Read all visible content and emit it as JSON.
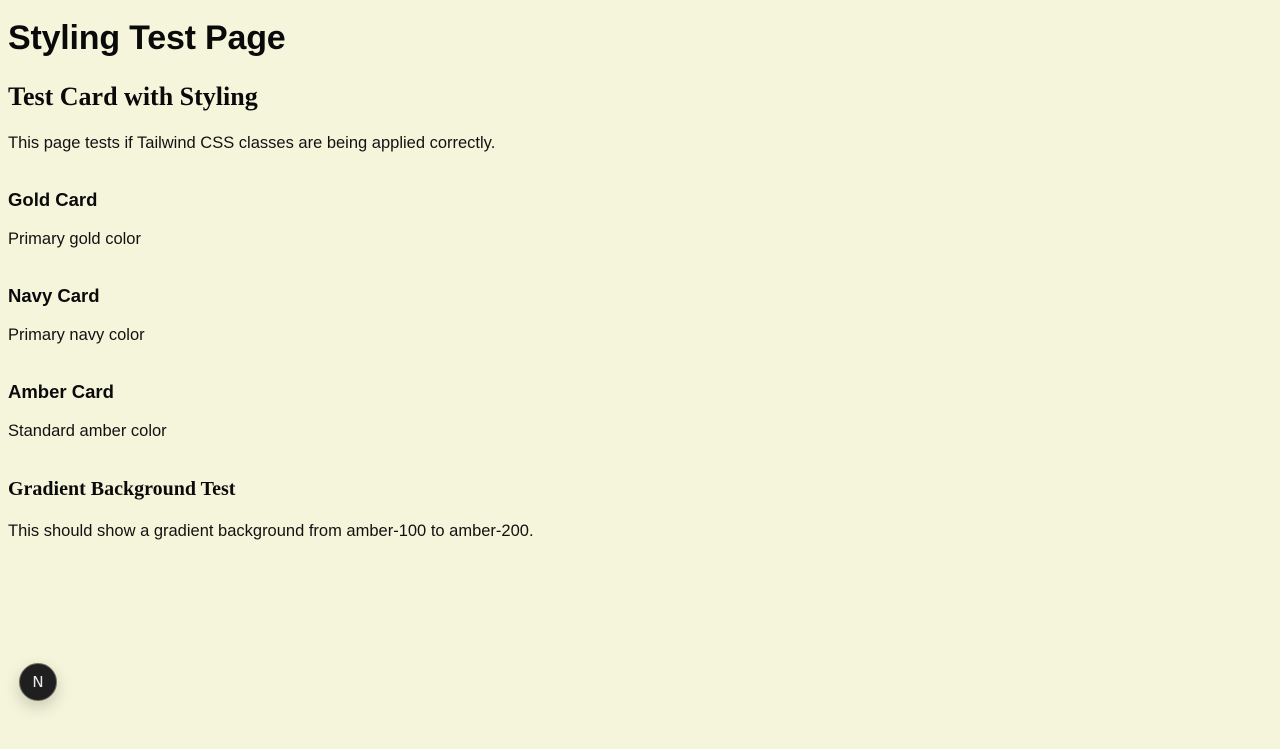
{
  "page": {
    "title": "Styling Test Page"
  },
  "test_card": {
    "title": "Test Card with Styling",
    "description": "This page tests if Tailwind CSS classes are being applied correctly."
  },
  "cards": [
    {
      "title": "Gold Card",
      "description": "Primary gold color"
    },
    {
      "title": "Navy Card",
      "description": "Primary navy color"
    },
    {
      "title": "Amber Card",
      "description": "Standard amber color"
    }
  ],
  "gradient": {
    "title": "Gradient Background Test",
    "description": "This should show a gradient background from amber-100 to amber-200."
  },
  "dev_badge": {
    "letter": "N",
    "icon": "nextjs-icon"
  },
  "colors": {
    "background": "#f5f5dc",
    "text": "#0a0a0a",
    "badge_bg": "#1f1f1f"
  }
}
